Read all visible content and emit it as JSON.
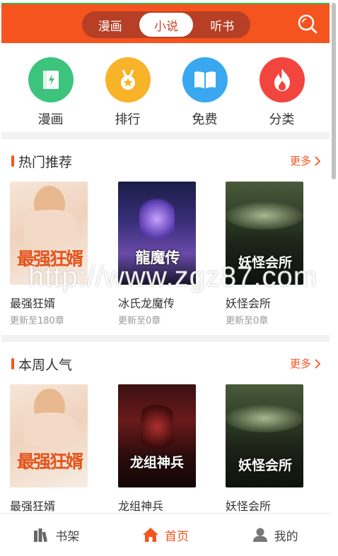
{
  "header": {
    "tabs": [
      {
        "label": "漫画",
        "active": false
      },
      {
        "label": "小说",
        "active": true
      },
      {
        "label": "听书",
        "active": false
      }
    ],
    "search_icon": "search-icon",
    "accent_color": "#f5541f"
  },
  "categories": [
    {
      "label": "漫画",
      "icon": "book-icon",
      "color": "#3cc47c"
    },
    {
      "label": "排行",
      "icon": "medal-icon",
      "color": "#f8b328"
    },
    {
      "label": "免费",
      "icon": "open-book-icon",
      "color": "#3aa8f0"
    },
    {
      "label": "分类",
      "icon": "flame-icon",
      "color": "#f2453d"
    }
  ],
  "hot": {
    "title": "热门推荐",
    "more": "更多",
    "books": [
      {
        "title": "最强狂婿",
        "sub": "更新至180章",
        "cover_text": "最强狂婿"
      },
      {
        "title": "冰氏龙魔传",
        "sub": "更新至0章",
        "cover_text": "龍魔传"
      },
      {
        "title": "妖怪会所",
        "sub": "更新至0章",
        "cover_text": "妖怪会所"
      }
    ]
  },
  "weekly": {
    "title": "本周人气",
    "more": "更多",
    "books": [
      {
        "title": "最强狂婿",
        "cover_text": "最强狂婿"
      },
      {
        "title": "龙组神兵",
        "cover_text": "龙组神兵"
      },
      {
        "title": "妖怪会所",
        "cover_text": "妖怪会所"
      }
    ]
  },
  "watermark": "http://www.zgz87.com",
  "tabbar": [
    {
      "label": "书架",
      "icon": "bookshelf-icon",
      "active": false
    },
    {
      "label": "首页",
      "icon": "home-icon",
      "active": true
    },
    {
      "label": "我的",
      "icon": "user-icon",
      "active": false
    }
  ]
}
